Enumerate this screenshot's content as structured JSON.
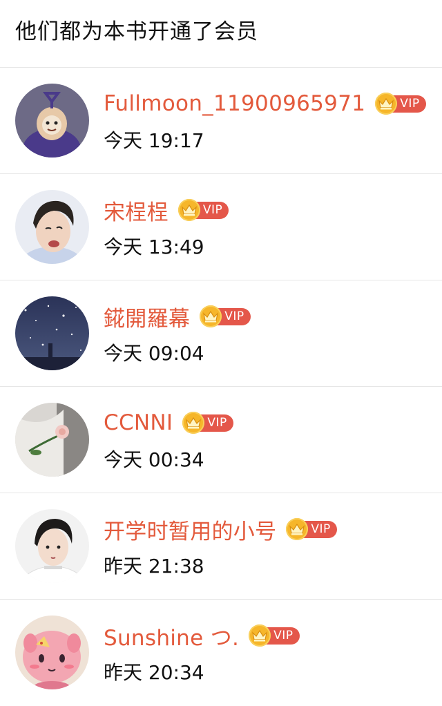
{
  "header": {
    "title": "他们都为本书开通了会员"
  },
  "members": [
    {
      "name": "Fullmoon_11900965971",
      "badge": "VIP",
      "time": "今天 19:17"
    },
    {
      "name": "宋桯桯",
      "badge": "VIP",
      "time": "今天 13:49"
    },
    {
      "name": "錵開羅幕",
      "badge": "VIP",
      "time": "今天 09:04"
    },
    {
      "name": "CCNNI",
      "badge": "VIP",
      "time": "今天 00:34"
    },
    {
      "name": "开学时暂用的小号",
      "badge": "VIP",
      "time": "昨天 21:38"
    },
    {
      "name": "Sunshine つ.",
      "badge": "VIP",
      "time": "昨天 20:34"
    }
  ],
  "colors": {
    "name": "#e35a3c",
    "vip_label_bg": "#e4574a",
    "vip_crown": "#f6b62a",
    "divider": "#e6e6e6"
  },
  "icons": {
    "vip_badge": "crown-vip-icon"
  }
}
